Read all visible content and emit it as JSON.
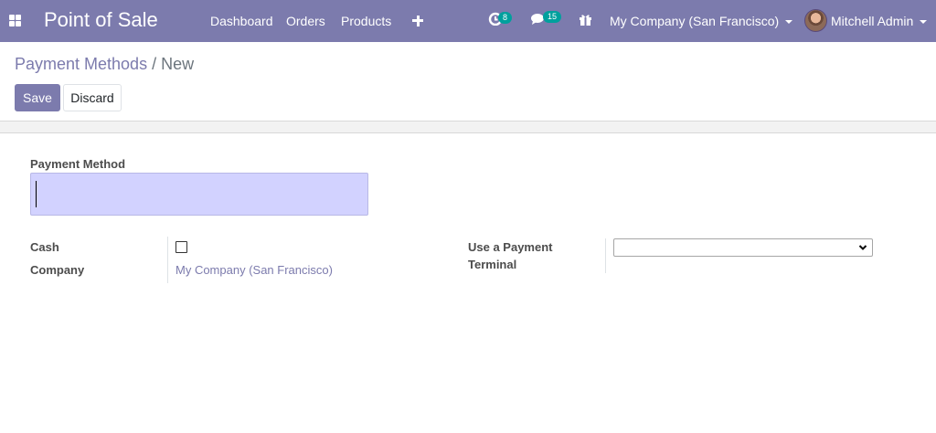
{
  "navbar": {
    "app_title": "Point of Sale",
    "menu_items": [
      "Dashboard",
      "Orders",
      "Products"
    ],
    "activity_badge": "8",
    "messages_badge": "15",
    "company": "My Company (San Francisco)",
    "user": "Mitchell Admin",
    "color": "#7c7bad"
  },
  "breadcrumb": {
    "parent": "Payment Methods",
    "separator": "/",
    "current": "New"
  },
  "buttons": {
    "save": "Save",
    "discard": "Discard"
  },
  "form": {
    "title_label": "Payment Method",
    "name_value": "",
    "cash_label": "Cash",
    "cash_checked": false,
    "company_label": "Company",
    "company_value": "My Company (San Francisco)",
    "terminal_label_line1": "Use a Payment",
    "terminal_label_line2": "Terminal",
    "terminal_value": ""
  },
  "icons": {
    "apps": "apps-grid-icon",
    "plus": "plus-icon",
    "activity": "clock-activity-icon",
    "messages": "chat-bubbles-icon",
    "gift": "gift-icon",
    "dropdown": "caret-down-icon"
  }
}
